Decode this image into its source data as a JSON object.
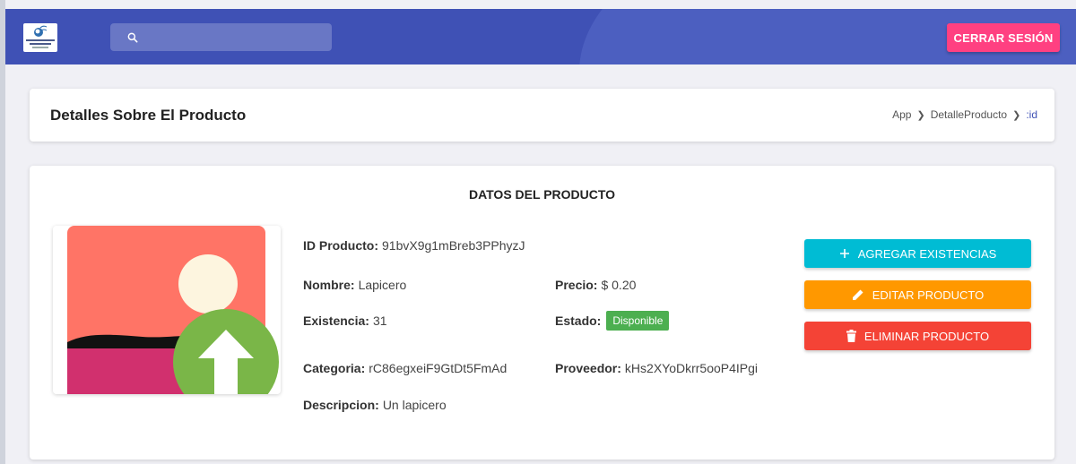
{
  "topbar": {
    "search_placeholder": "",
    "logout_label": "CERRAR SESIÓN",
    "colors": {
      "bar": "#3f51b5",
      "logout": "#ff4081"
    }
  },
  "header": {
    "title": "Detalles Sobre El Producto",
    "breadcrumb": [
      "App",
      "DetalleProducto",
      ":id"
    ]
  },
  "product": {
    "section_title": "DATOS DEL PRODUCTO",
    "image_icon": "image-upload-placeholder-icon",
    "fields": {
      "id": {
        "label": "ID Producto:",
        "value": "91bvX9g1mBreb3PPhyzJ"
      },
      "name": {
        "label": "Nombre:",
        "value": "Lapicero"
      },
      "price": {
        "label": "Precio:",
        "value": "$ 0.20"
      },
      "stock": {
        "label": "Existencia:",
        "value": "31"
      },
      "status": {
        "label": "Estado:",
        "value": "Disponible"
      },
      "category": {
        "label": "Categoria:",
        "value": "rC86egxeiF9GtDt5FmAd"
      },
      "provider": {
        "label": "Proveedor:",
        "value": "kHs2XYoDkrr5ooP4IPgi"
      },
      "description": {
        "label": "Descripcion:",
        "value": "Un lapicero"
      }
    }
  },
  "actions": {
    "add": {
      "label": "AGREGAR EXISTENCIAS",
      "icon": "plus-icon",
      "color": "#00bcd4"
    },
    "edit": {
      "label": "EDITAR PRODUCTO",
      "icon": "pencil-icon",
      "color": "#ff9800"
    },
    "delete": {
      "label": "ELIMINAR PRODUCTO",
      "icon": "trash-icon",
      "color": "#f44336"
    }
  }
}
